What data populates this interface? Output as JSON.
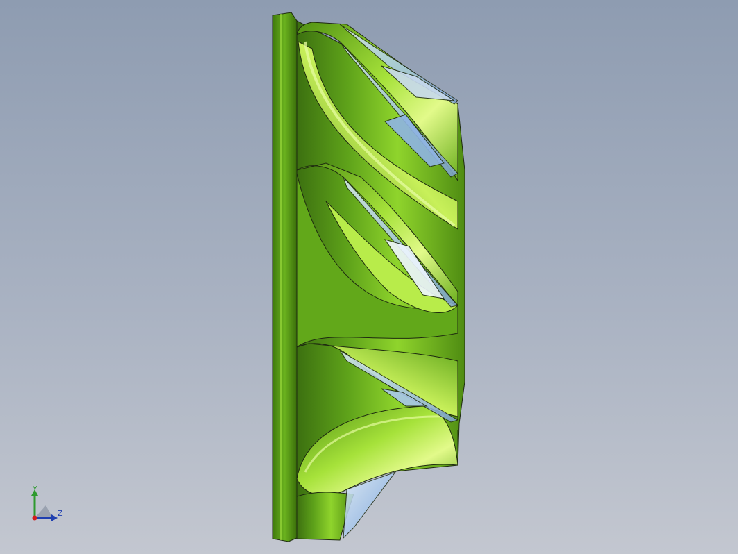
{
  "viewport": {
    "background_top": "#8e9cb1",
    "background_bottom": "#c3c7d0"
  },
  "model": {
    "part_color": "#6cb01e",
    "highlight_color": "#c8f05a",
    "shadow_color": "#2f5c08",
    "edge_color": "#1e2a10",
    "glass_color": "#a9c8ec"
  },
  "triad": {
    "y_label": "Y",
    "z_label": "Z",
    "y_color": "#2e9a2e",
    "z_color": "#1f3fb0",
    "x_color": "#d11d1d"
  }
}
